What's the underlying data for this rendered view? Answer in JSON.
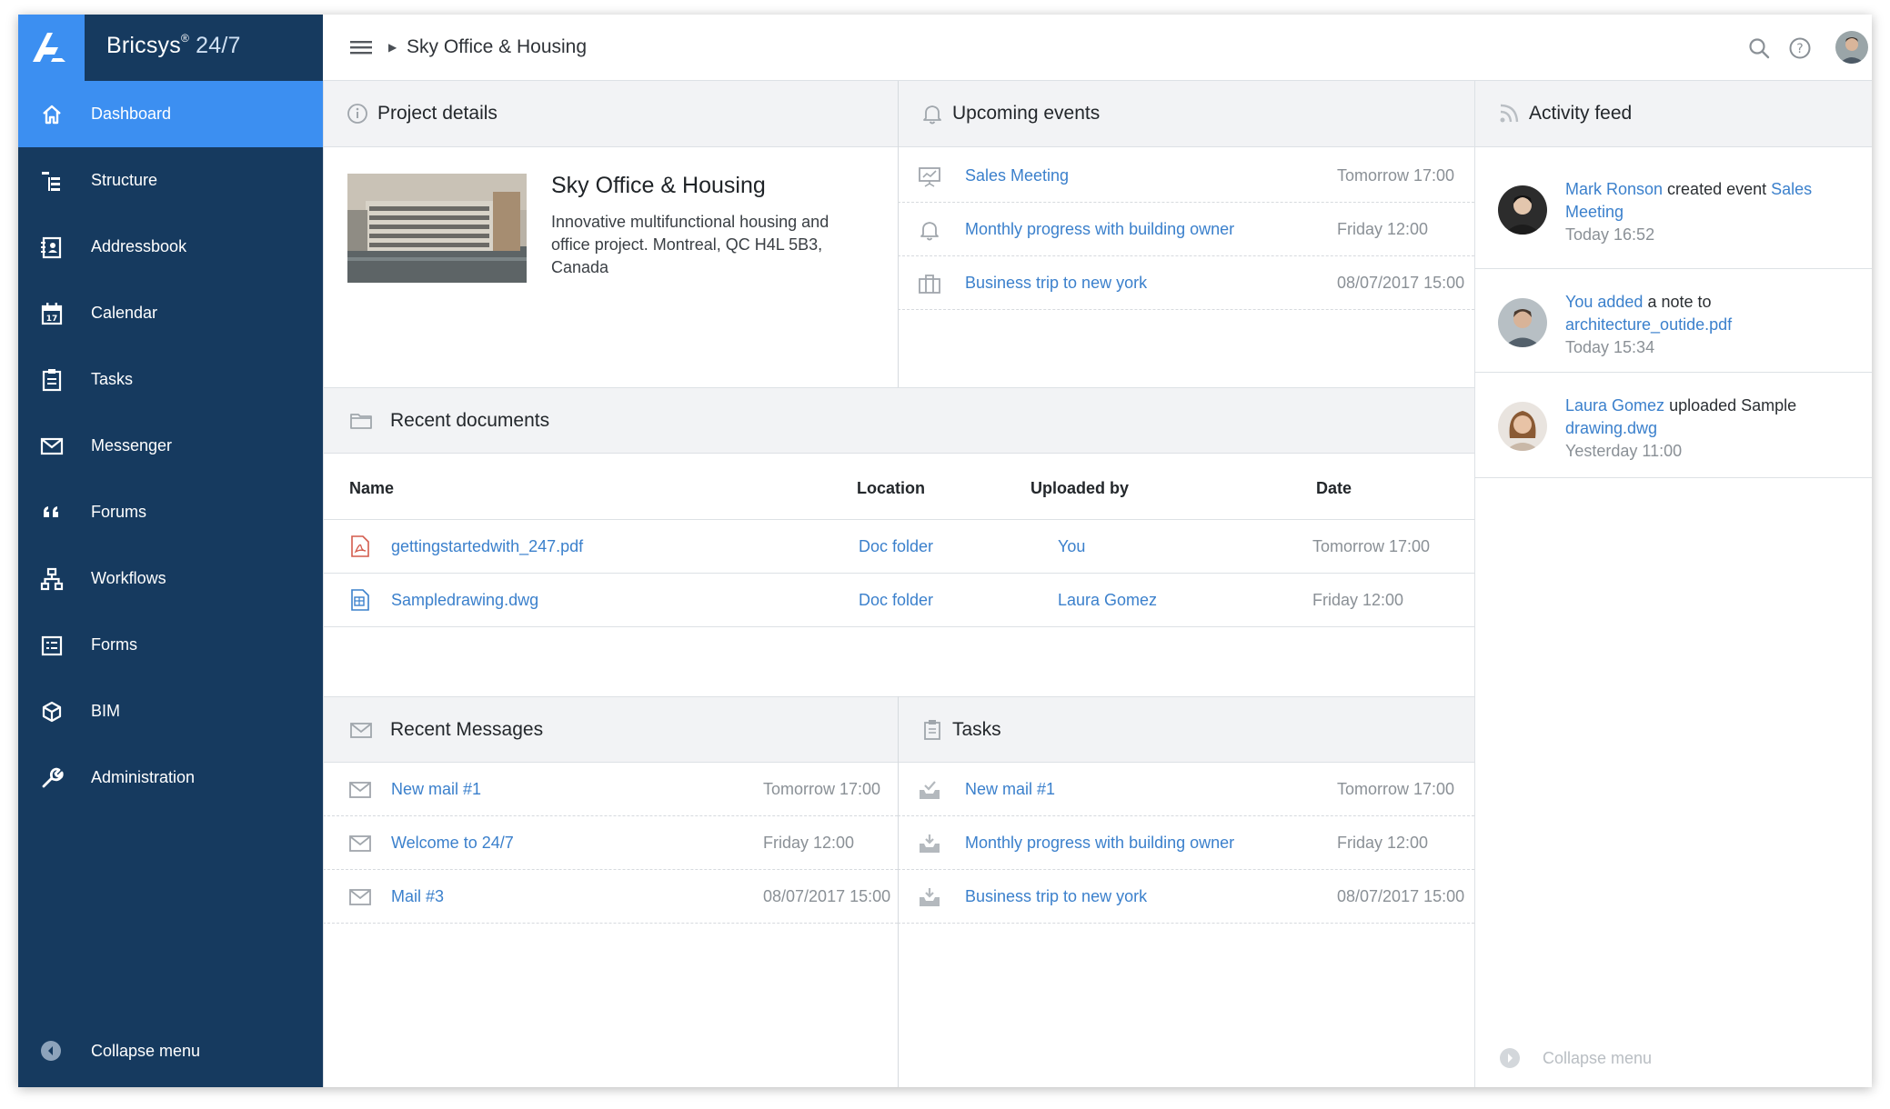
{
  "brand": {
    "name": "Bricsys",
    "reg": "®",
    "product": "24/7"
  },
  "nav": {
    "items": [
      {
        "id": "dashboard",
        "label": "Dashboard",
        "icon": "home-icon",
        "active": true
      },
      {
        "id": "structure",
        "label": "Structure",
        "icon": "tree-structure-icon"
      },
      {
        "id": "addressbook",
        "label": "Addressbook",
        "icon": "addressbook-icon"
      },
      {
        "id": "calendar",
        "label": "Calendar",
        "icon": "calendar-icon"
      },
      {
        "id": "tasks",
        "label": "Tasks",
        "icon": "clipboard-icon"
      },
      {
        "id": "messenger",
        "label": "Messenger",
        "icon": "envelope-icon"
      },
      {
        "id": "forums",
        "label": "Forums",
        "icon": "quote-icon"
      },
      {
        "id": "workflows",
        "label": "Workflows",
        "icon": "hierarchy-icon"
      },
      {
        "id": "forms",
        "label": "Forms",
        "icon": "form-icon"
      },
      {
        "id": "bim",
        "label": "BIM",
        "icon": "cube-icon"
      },
      {
        "id": "administration",
        "label": "Administration",
        "icon": "wrench-icon"
      }
    ],
    "collapse_label": "Collapse menu"
  },
  "topbar": {
    "breadcrumb": "Sky Office & Housing"
  },
  "project": {
    "header": "Project details",
    "name": "Sky Office & Housing",
    "description": "Innovative multifunctional housing and office project. Montreal, QC H4L 5B3, Canada"
  },
  "events": {
    "header": "Upcoming events",
    "items": [
      {
        "title": "Sales Meeting",
        "date": "Tomorrow 17:00",
        "icon": "presentation-icon"
      },
      {
        "title": "Monthly progress with building owner",
        "date": "Friday 12:00",
        "icon": "bell-icon"
      },
      {
        "title": "Business trip to new york",
        "date": "08/07/2017 15:00",
        "icon": "briefcase-icon"
      }
    ]
  },
  "documents": {
    "header": "Recent documents",
    "columns": {
      "name": "Name",
      "location": "Location",
      "uploaded_by": "Uploaded by",
      "date": "Date"
    },
    "rows": [
      {
        "name": "gettingstartedwith_247.pdf",
        "location": "Doc folder",
        "uploaded_by": "You",
        "date": "Tomorrow 17:00",
        "icon": "pdf-file-icon"
      },
      {
        "name": "Sampledrawing.dwg",
        "location": "Doc folder",
        "uploaded_by": "Laura Gomez",
        "date": "Friday 12:00",
        "icon": "dwg-file-icon"
      }
    ]
  },
  "messages": {
    "header": "Recent Messages",
    "items": [
      {
        "title": "New mail #1",
        "date": "Tomorrow 17:00"
      },
      {
        "title": "Welcome to 24/7",
        "date": "Friday 12:00"
      },
      {
        "title": "Mail #3",
        "date": "08/07/2017 15:00"
      }
    ]
  },
  "tasks": {
    "header": "Tasks",
    "items": [
      {
        "title": "New mail #1",
        "date": "Tomorrow 17:00",
        "icon": "tray-check-icon"
      },
      {
        "title": "Monthly progress with building owner",
        "date": "Friday 12:00",
        "icon": "tray-download-icon"
      },
      {
        "title": "Business trip to new york",
        "date": "08/07/2017 15:00",
        "icon": "tray-download-icon"
      }
    ]
  },
  "activity": {
    "header": "Activity feed",
    "items": [
      {
        "actor": "Mark Ronson",
        "action": " created event ",
        "target": "Sales Meeting",
        "time": "Today 16:52"
      },
      {
        "actor": "You added",
        "action": " a note to ",
        "target": "architecture_outide.pdf",
        "time": "Today 15:34"
      },
      {
        "actor": "Laura Gomez",
        "action": " uploaded Sample ",
        "target": "drawing.dwg",
        "time": "Yesterday 11:00"
      }
    ],
    "collapse_label": "Collapse menu"
  },
  "colors": {
    "sidebar": "#163a5f",
    "accent": "#3c8ff1",
    "link": "#3b80cc",
    "panel_header": "#f2f3f5"
  }
}
